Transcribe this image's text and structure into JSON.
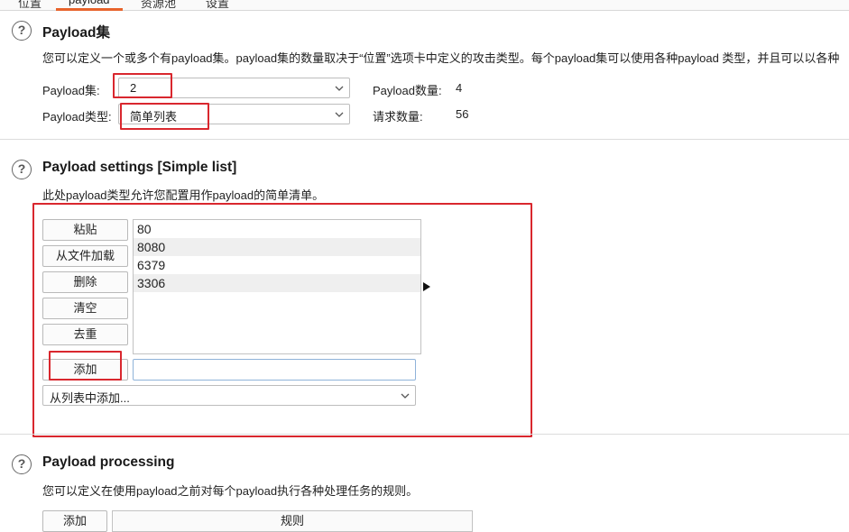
{
  "tabs": [
    "位置",
    "payload",
    "资源池",
    "设置"
  ],
  "active_tab": "payload",
  "accent_color": "#e8632b",
  "highlight_color": "#d9272e",
  "payload_sets": {
    "title": "Payload集",
    "description": "您可以定义一个或多个有payload集。payload集的数量取决于“位置”选项卡中定义的攻击类型。每个payload集可以使用各种payload 类型，并且可以以各种",
    "set_label": "Payload集:",
    "set_value": "2",
    "type_label": "Payload类型:",
    "type_value": "简单列表",
    "count_label": "Payload数量:",
    "count_value": "4",
    "requests_label": "请求数量:",
    "requests_value": "56"
  },
  "payload_settings": {
    "title": "Payload settings [Simple list]",
    "description": "此处payload类型允许您配置用作payload的简单清单。",
    "buttons": [
      "粘贴",
      "从文件加载",
      "删除",
      "清空",
      "去重"
    ],
    "add_button": "添加",
    "add_input_value": "",
    "items": [
      "80",
      "8080",
      "6379",
      "3306"
    ],
    "add_from_list": "从列表中添加..."
  },
  "payload_processing": {
    "title": "Payload processing",
    "description": "您可以定义在使用payload之前对每个payload执行各种处理任务的规则。",
    "add_button": "添加",
    "rules_header": "规则"
  }
}
